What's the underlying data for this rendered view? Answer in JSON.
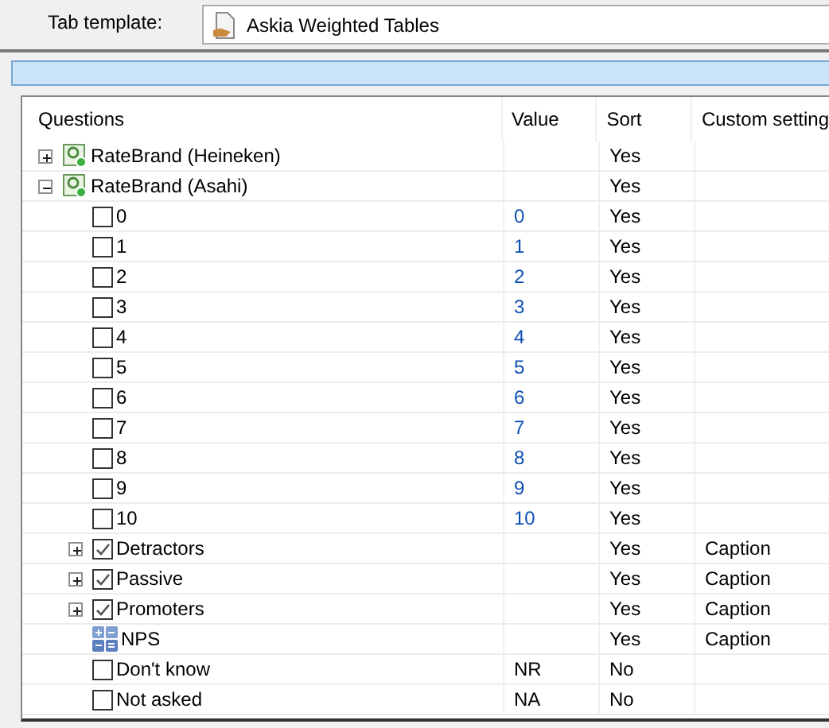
{
  "template": {
    "label": "Tab template:",
    "value": "Askia Weighted Tables"
  },
  "table": {
    "columns": [
      "Questions",
      "Value",
      "Sort",
      "Custom setting"
    ],
    "rows": [
      {
        "kind": "question",
        "label": "RateBrand (Heineken)",
        "sort": "Yes",
        "expanded": false
      },
      {
        "kind": "question",
        "label": "RateBrand (Asahi)",
        "sort": "Yes",
        "expanded": true,
        "children": [
          {
            "kind": "response",
            "label": "0",
            "value": "0",
            "sort": "Yes",
            "checked": false
          },
          {
            "kind": "response",
            "label": "1",
            "value": "1",
            "sort": "Yes",
            "checked": false
          },
          {
            "kind": "response",
            "label": "2",
            "value": "2",
            "sort": "Yes",
            "checked": false
          },
          {
            "kind": "response",
            "label": "3",
            "value": "3",
            "sort": "Yes",
            "checked": false
          },
          {
            "kind": "response",
            "label": "4",
            "value": "4",
            "sort": "Yes",
            "checked": false
          },
          {
            "kind": "response",
            "label": "5",
            "value": "5",
            "sort": "Yes",
            "checked": false
          },
          {
            "kind": "response",
            "label": "6",
            "value": "6",
            "sort": "Yes",
            "checked": false
          },
          {
            "kind": "response",
            "label": "7",
            "value": "7",
            "sort": "Yes",
            "checked": false
          },
          {
            "kind": "response",
            "label": "8",
            "value": "8",
            "sort": "Yes",
            "checked": false
          },
          {
            "kind": "response",
            "label": "9",
            "value": "9",
            "sort": "Yes",
            "checked": false
          },
          {
            "kind": "response",
            "label": "10",
            "value": "10",
            "sort": "Yes",
            "checked": false
          },
          {
            "kind": "group",
            "label": "Detractors",
            "sort": "Yes",
            "custom": "Caption",
            "checked": true,
            "expanded": false
          },
          {
            "kind": "group",
            "label": "Passive",
            "sort": "Yes",
            "custom": "Caption",
            "checked": true,
            "expanded": false
          },
          {
            "kind": "group",
            "label": "Promoters",
            "sort": "Yes",
            "custom": "Caption",
            "checked": true,
            "expanded": false
          },
          {
            "kind": "calculation",
            "label": "NPS",
            "sort": "Yes",
            "custom": "Caption"
          },
          {
            "kind": "missing",
            "label": "Don't know",
            "value": "NR",
            "sort": "No",
            "checked": false
          },
          {
            "kind": "missing",
            "label": "Not asked",
            "value": "NA",
            "sort": "No",
            "checked": false
          }
        ]
      }
    ]
  }
}
